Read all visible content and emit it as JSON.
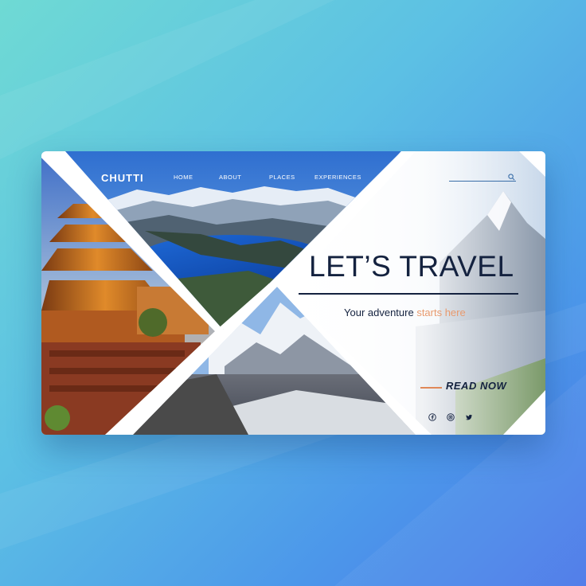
{
  "brand": {
    "name": "CHUTTI"
  },
  "nav": [
    {
      "label": "HOME"
    },
    {
      "label": "ABOUT"
    },
    {
      "label": "PLACES"
    },
    {
      "label": "EXPERIENCES"
    }
  ],
  "hero": {
    "headline": "LET’S TRAVEL",
    "tagline_start": "Your adventure ",
    "tagline_accent": "starts here",
    "cta_label": "READ NOW"
  },
  "social": [
    "facebook-icon",
    "instagram-icon",
    "twitter-icon"
  ],
  "colors": {
    "navy": "#14223f",
    "accent": "#e89a6e",
    "cta_rule": "#e08858",
    "bg_start": "#6fdad4",
    "bg_end": "#4a78e8"
  }
}
